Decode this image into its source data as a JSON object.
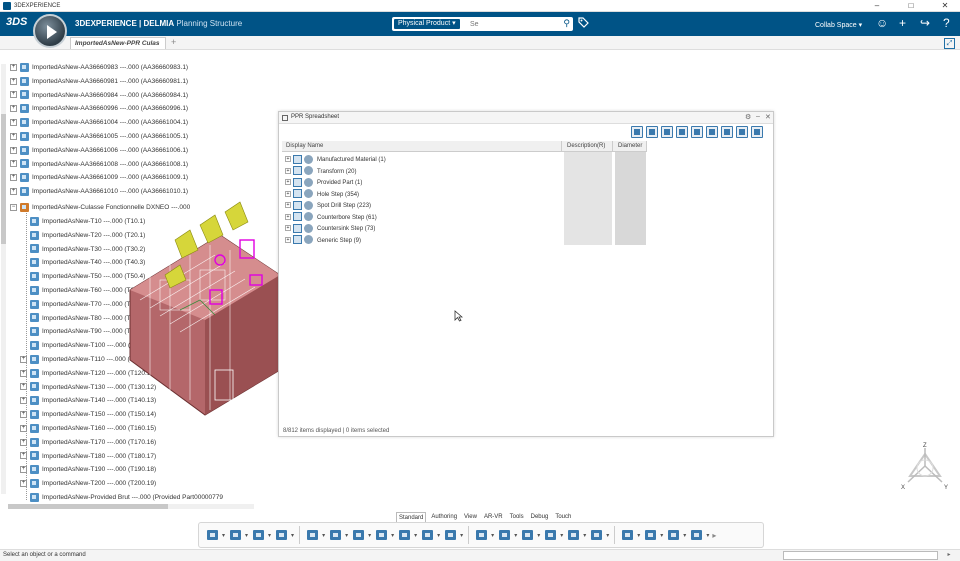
{
  "os_window": {
    "title": "3DEXPERIENCE",
    "minimize": "–",
    "maximize": "□",
    "close": "✕"
  },
  "header": {
    "logo": "3DS",
    "brand_bold": "3DEXPERIENCE | DELMIA",
    "app_name": "Planning Structure",
    "search_scope": "Physical Product ▾",
    "search_placeholder": "Se",
    "search_go": "⚲",
    "tag_icon": "🏷",
    "collab_space": "Collab Space ▾",
    "icons": [
      "user-icon",
      "plus-icon",
      "share-icon",
      "help-icon"
    ],
    "icon_glyphs": [
      "☺",
      "+",
      "↪",
      "?"
    ]
  },
  "tabs": {
    "doc_tab": "ImportedAsNew-PPR Culas",
    "add": "+"
  },
  "tree": {
    "top_rows": [
      "ImportedAsNew-AA36660983 ---.000 (AA36660983.1)",
      "ImportedAsNew-AA36660981 ---.000 (AA36660981.1)",
      "ImportedAsNew-AA36660984 ---.000 (AA36660984.1)",
      "ImportedAsNew-AA36660996 ---.000 (AA36660996.1)",
      "ImportedAsNew-AA36661004 ---.000 (AA36661004.1)",
      "ImportedAsNew-AA36661005 ---.000 (AA36661005.1)",
      "ImportedAsNew-AA36661006 ---.000 (AA36661006.1)",
      "ImportedAsNew-AA36661008 ---.000 (AA36661008.1)",
      "ImportedAsNew-AA36661009 ---.000 (AA36661009.1)",
      "ImportedAsNew-AA36661010 ---.000 (AA36661010.1)"
    ],
    "root": "ImportedAsNew-Culasse Fonctionnelle DXNEO ---.000",
    "children": [
      {
        "label": "ImportedAsNew-T10 ---.000 (T10.1)",
        "expandable": false
      },
      {
        "label": "ImportedAsNew-T20 ---.000 (T20.1)",
        "expandable": false
      },
      {
        "label": "ImportedAsNew-T30 ---.000 (T30.2)",
        "expandable": false
      },
      {
        "label": "ImportedAsNew-T40 ---.000 (T40.3)",
        "expandable": false
      },
      {
        "label": "ImportedAsNew-T50 ---.000 (T50.4)",
        "expandable": false
      },
      {
        "label": "ImportedAsNew-T60 ---.000 (T60.5)",
        "expandable": false
      },
      {
        "label": "ImportedAsNew-T70 ---.000 (T70.6)",
        "expandable": false
      },
      {
        "label": "ImportedAsNew-T80 ---.000 (T80.7)",
        "expandable": false
      },
      {
        "label": "ImportedAsNew-T90 ---.000 (T90.8)",
        "expandable": false
      },
      {
        "label": "ImportedAsNew-T100 ---.000 (T100.9)",
        "expandable": false
      },
      {
        "label": "ImportedAsNew-T110 ---.000 (T110.10)",
        "expandable": true
      },
      {
        "label": "ImportedAsNew-T120 ---.000 (T120.11)",
        "expandable": true
      },
      {
        "label": "ImportedAsNew-T130 ---.000 (T130.12)",
        "expandable": true
      },
      {
        "label": "ImportedAsNew-T140 ---.000 (T140.13)",
        "expandable": true
      },
      {
        "label": "ImportedAsNew-T150 ---.000 (T150.14)",
        "expandable": true
      },
      {
        "label": "ImportedAsNew-T160 ---.000 (T160.15)",
        "expandable": true
      },
      {
        "label": "ImportedAsNew-T170 ---.000 (T170.16)",
        "expandable": true
      },
      {
        "label": "ImportedAsNew-T180 ---.000 (T180.17)",
        "expandable": true
      },
      {
        "label": "ImportedAsNew-T190 ---.000 (T190.18)",
        "expandable": true
      },
      {
        "label": "ImportedAsNew-T200 ---.000 (T200.19)",
        "expandable": true
      }
    ],
    "last_row": "ImportedAsNew-Provided Brut ---.000 (Provided Part00000779"
  },
  "ppr": {
    "title": "PPR Spreadsheet",
    "window_buttons": [
      "⚙",
      "–",
      "✕"
    ],
    "toolbar_icons": [
      "filter-icon",
      "export-icon",
      "column-icon",
      "add-icon",
      "refresh-icon",
      "settings-icon",
      "document-icon",
      "sheet-icon",
      "table-icon"
    ],
    "columns": [
      "Display Name",
      "Description(R)",
      "Diameter"
    ],
    "rows": [
      "Manufactured Material (1)",
      "Transform (20)",
      "Provided Part (1)",
      "Hole Step (354)",
      "Spot Drill Step (223)",
      "Counterbore Step (61)",
      "Countersink Step (73)",
      "Generic Step (9)"
    ],
    "status": "8/812 items displayed | 0 items selected"
  },
  "triad": {
    "z": "Z",
    "x": "X",
    "y": "Y"
  },
  "action_tabs": [
    "Standard",
    "Authoring",
    "View",
    "AR-VR",
    "Tools",
    "Debug",
    "Touch"
  ],
  "active_action_tab": "Standard",
  "toolbar_tools": [
    "cut-icon",
    "copy-icon",
    "paste-icon",
    "undo-icon",
    "3d-box-icon",
    "assembly-icon",
    "tree-icon",
    "scissors-icon",
    "frame-icon",
    "link-icon",
    "cube-icon",
    "rotate-icon",
    "swap-icon",
    "time-icon",
    "layout-icon",
    "structure-icon",
    "table-icon",
    "gantt-icon",
    "gear-icon",
    "list-icon",
    "close-icon"
  ],
  "status": {
    "message": "Select an object or a command",
    "scroll": "▸"
  }
}
